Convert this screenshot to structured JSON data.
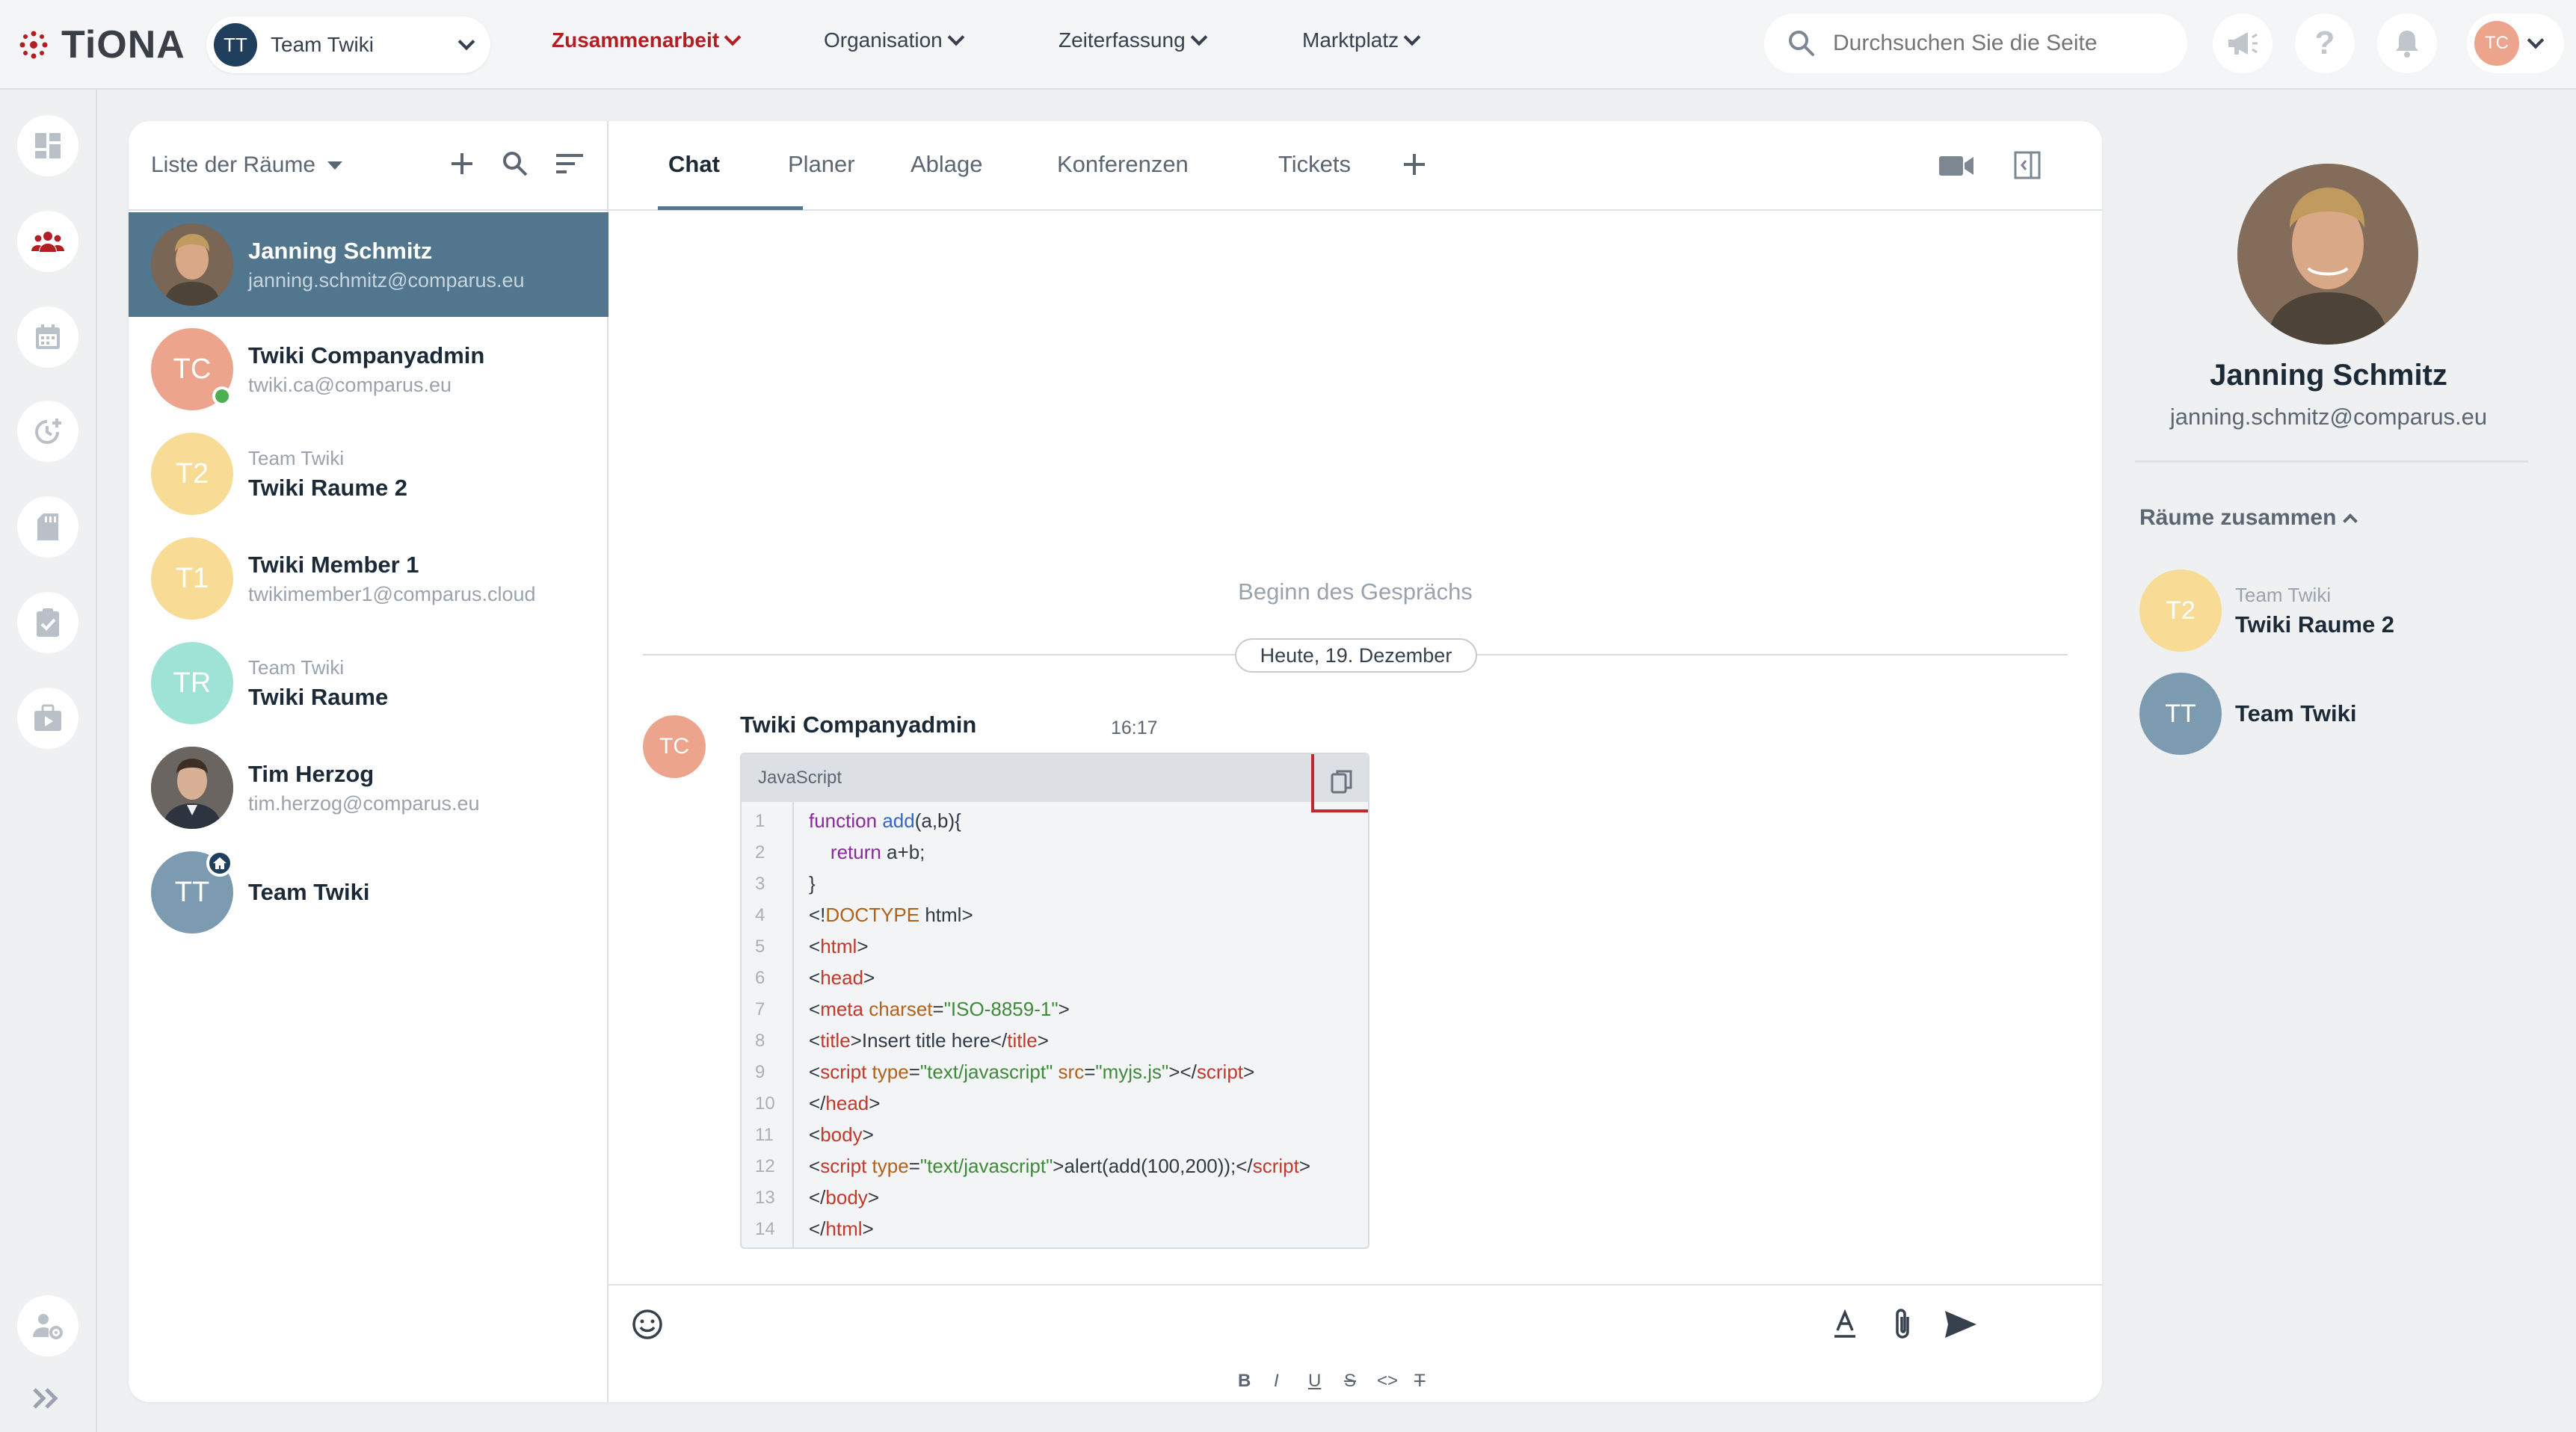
{
  "brand": {
    "name": "TiONA",
    "accent": "#b41e23"
  },
  "team_select": {
    "initials": "TT",
    "name": "Team Twiki"
  },
  "nav": {
    "items": [
      "Zusammenarbeit",
      "Organisation",
      "Zeiterfassung",
      "Marktplatz"
    ],
    "active": "Zusammenarbeit"
  },
  "search": {
    "placeholder": "Durchsuchen Sie die Seite"
  },
  "user": {
    "initials": "TC"
  },
  "rooms_panel": {
    "title": "Liste der Räume",
    "rooms": [
      {
        "name": "Janning Schmitz",
        "sub": "janning.schmitz@comparus.eu",
        "selected": true
      },
      {
        "initials": "TC",
        "name": "Twiki Companyadmin",
        "sub": "twiki.ca@comparus.eu",
        "online": true
      },
      {
        "initials": "T2",
        "over": "Team Twiki",
        "name": "Twiki Raume 2"
      },
      {
        "initials": "T1",
        "name": "Twiki Member 1",
        "sub": "twikimember1@comparus.cloud"
      },
      {
        "initials": "TR",
        "over": "Team Twiki",
        "name": "Twiki Raume"
      },
      {
        "name": "Tim Herzog",
        "sub": "tim.herzog@comparus.eu"
      },
      {
        "initials": "TT",
        "name": "Team Twiki",
        "home": true
      }
    ]
  },
  "tabs": [
    "Chat",
    "Planer",
    "Ablage",
    "Konferenzen",
    "Tickets"
  ],
  "active_tab": "Chat",
  "chat": {
    "conversation_start": "Beginn des Gesprächs",
    "date_label": "Heute, 19. Dezember",
    "message": {
      "avatar_initials": "TC",
      "author": "Twiki Companyadmin",
      "time": "16:17",
      "code_language": "JavaScript",
      "line_numbers": [
        "1",
        "2",
        "3",
        "4",
        "5",
        "6",
        "7",
        "8",
        "9",
        "10",
        "11",
        "12",
        "13",
        "14"
      ]
    }
  },
  "formatting": {
    "bold": "B",
    "italic": "I",
    "underline": "U",
    "strike": "S",
    "code": "<>",
    "clear": "T"
  },
  "profile": {
    "name": "Janning Schmitz",
    "email": "janning.schmitz@comparus.eu",
    "rooms_together_label": "Räume zusammen",
    "rooms_together": [
      {
        "initials": "T2",
        "over": "Team Twiki",
        "name": "Twiki Raume 2"
      },
      {
        "initials": "TT",
        "name": "Team Twiki"
      }
    ]
  }
}
